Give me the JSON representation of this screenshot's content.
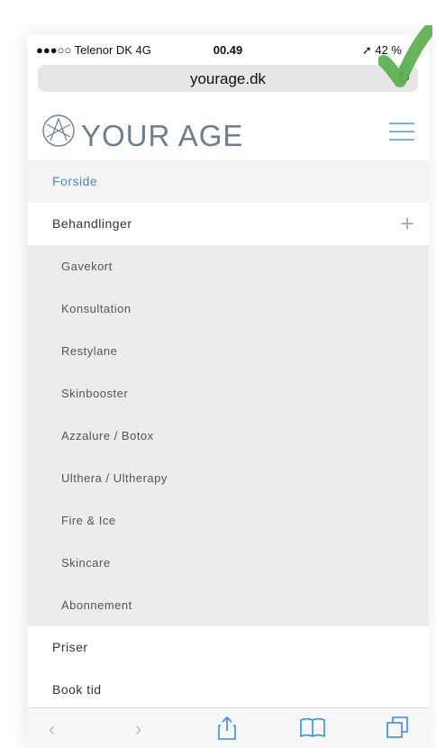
{
  "status": {
    "carrier": "●●●○○ Telenor DK  4G",
    "time": "00.49",
    "battery": "➚ 42 %"
  },
  "browser": {
    "url": "yourage.dk",
    "reload_icon": "reload-icon"
  },
  "site": {
    "brand": "YOUR AGE",
    "accent": "#3f8fc7"
  },
  "menu": {
    "forside": "Forside",
    "behandlinger": "Behandlinger",
    "subitems": [
      "Gavekort",
      "Konsultation",
      "Restylane",
      "Skinbooster",
      "Azzalure / Botox",
      "Ulthera / Ultherapy",
      "Fire & Ice",
      "Skincare",
      "Abonnement"
    ],
    "priser": "Priser",
    "book": "Book tid"
  },
  "toolbar": {
    "back": "‹",
    "forward": "›"
  }
}
